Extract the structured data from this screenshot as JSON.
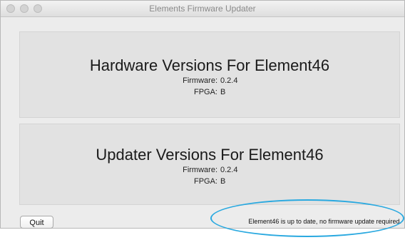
{
  "window": {
    "title": "Elements Firmware Updater"
  },
  "hardware": {
    "heading": "Hardware Versions For Element46",
    "firmware_label": "Firmware:",
    "firmware_value": "0.2.4",
    "fpga_label": "FPGA:",
    "fpga_value": "B"
  },
  "updater": {
    "heading": "Updater Versions For Element46",
    "firmware_label": "Firmware:",
    "firmware_value": "0.2.4",
    "fpga_label": "FPGA:",
    "fpga_value": "B"
  },
  "footer": {
    "quit_label": "Quit",
    "status_message": "Element46 is up to date, no firmware update required."
  },
  "colors": {
    "highlight": "#2aa9e0"
  }
}
